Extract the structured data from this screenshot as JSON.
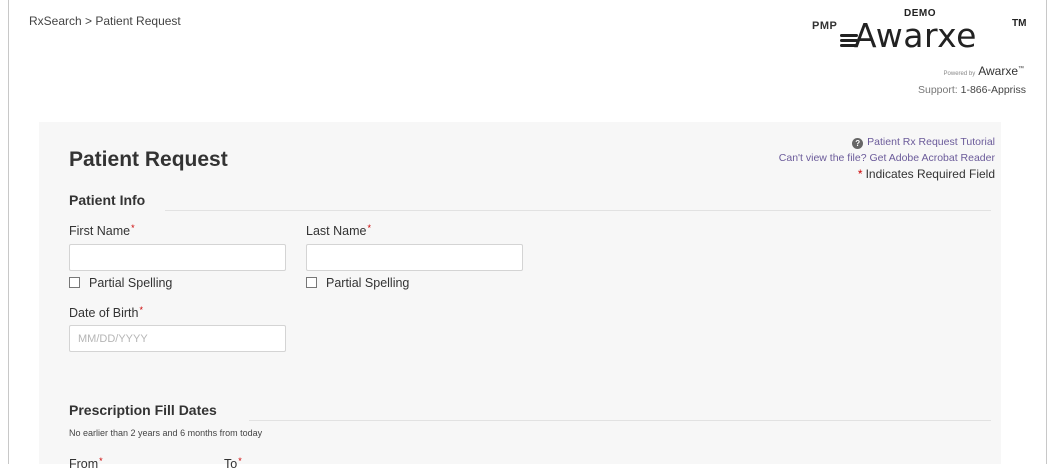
{
  "breadcrumb": "RxSearch > Patient Request",
  "logo": {
    "prefix": "PMP",
    "badge": "DEMO",
    "name": "Awarxe",
    "tm": "TM",
    "powered_by": "Powered by",
    "powered_name": "Awarxe",
    "powered_tm": "™"
  },
  "support": {
    "label": "Support:",
    "phone": "1-866-Appriss"
  },
  "links": {
    "tutorial": "Patient Rx Request Tutorial",
    "acrobat": "Can't view the file? Get Adobe Acrobat Reader",
    "required_star": "*",
    "required_note": "Indicates Required Field"
  },
  "page_title": "Patient Request",
  "patient_info": {
    "title": "Patient Info",
    "first_name_label": "First Name",
    "last_name_label": "Last Name",
    "required_star": "*",
    "first_name_value": "",
    "last_name_value": "",
    "partial_spelling_label": "Partial Spelling",
    "dob_label": "Date of Birth",
    "dob_value": "",
    "dob_placeholder": "MM/DD/YYYY"
  },
  "fill_dates": {
    "title": "Prescription Fill Dates",
    "note": "No earlier than 2 years and 6 months from today",
    "from_label": "From",
    "to_label": "To"
  }
}
